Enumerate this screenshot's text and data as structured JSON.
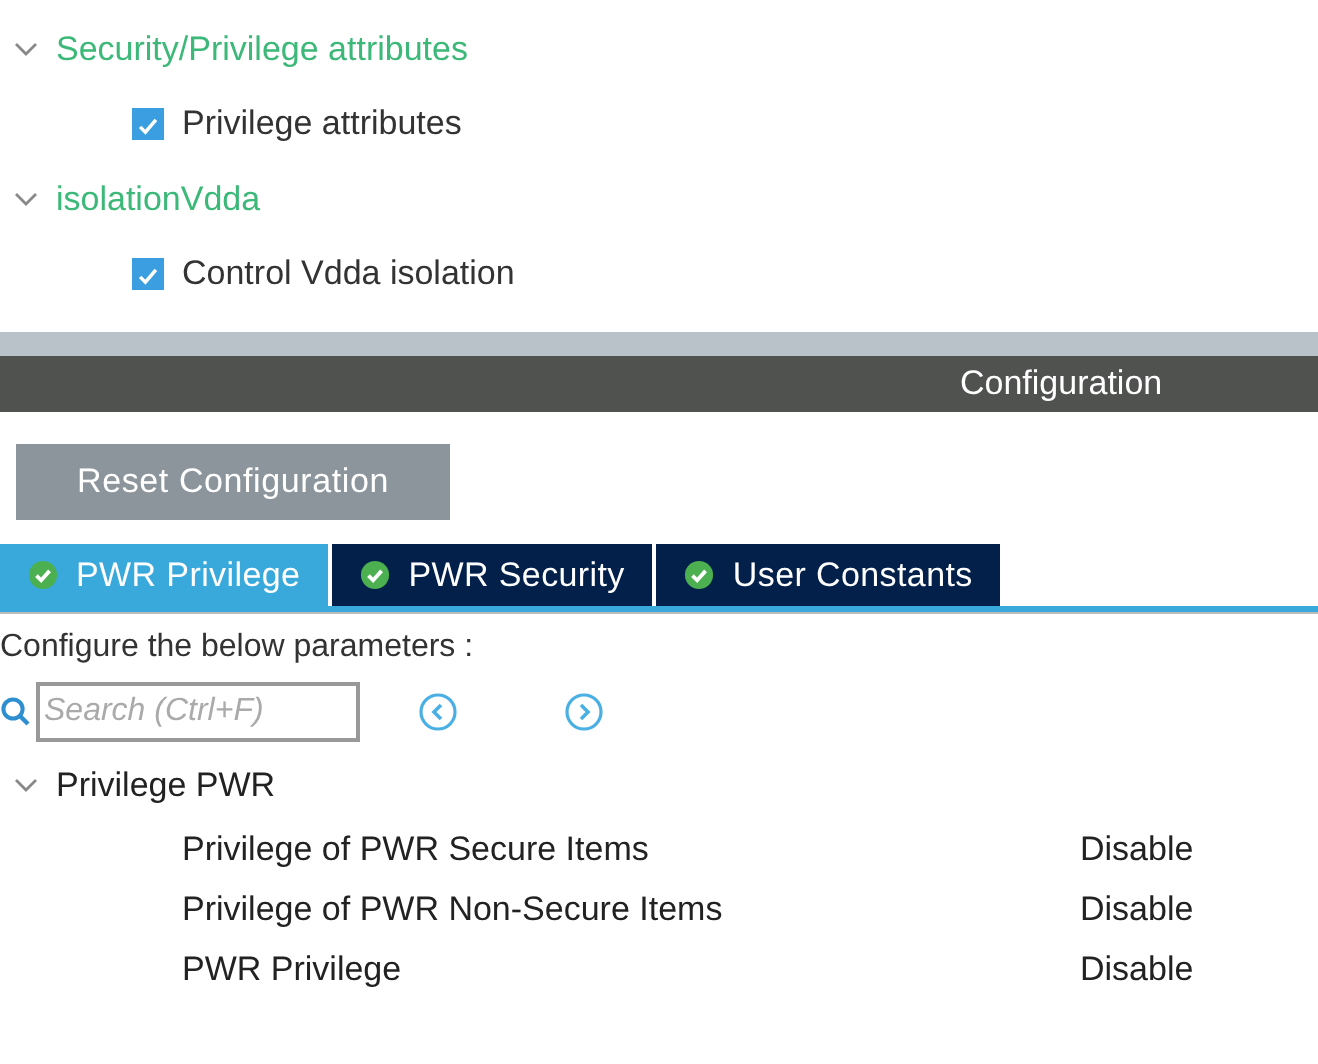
{
  "tree": [
    {
      "label": "Security/Privilege attributes",
      "expanded": true,
      "children": [
        {
          "label": "Privilege attributes",
          "checked": true
        }
      ]
    },
    {
      "label": "isolationVdda",
      "expanded": true,
      "children": [
        {
          "label": "Control Vdda isolation",
          "checked": true
        }
      ]
    }
  ],
  "panel_title": "Configuration",
  "reset_button": "Reset Configuration",
  "tabs": [
    {
      "label": "PWR Privilege",
      "selected": true
    },
    {
      "label": "PWR Security",
      "selected": false
    },
    {
      "label": "User Constants",
      "selected": false
    }
  ],
  "instructions": "Configure the below parameters :",
  "search": {
    "placeholder": "Search (Ctrl+F)"
  },
  "groups": [
    {
      "label": "Privilege PWR",
      "expanded": true,
      "params": [
        {
          "name": "Privilege of PWR Secure Items",
          "value": "Disable"
        },
        {
          "name": "Privilege of PWR Non-Secure Items",
          "value": "Disable"
        },
        {
          "name": "PWR Privilege",
          "value": "Disable"
        }
      ]
    }
  ]
}
